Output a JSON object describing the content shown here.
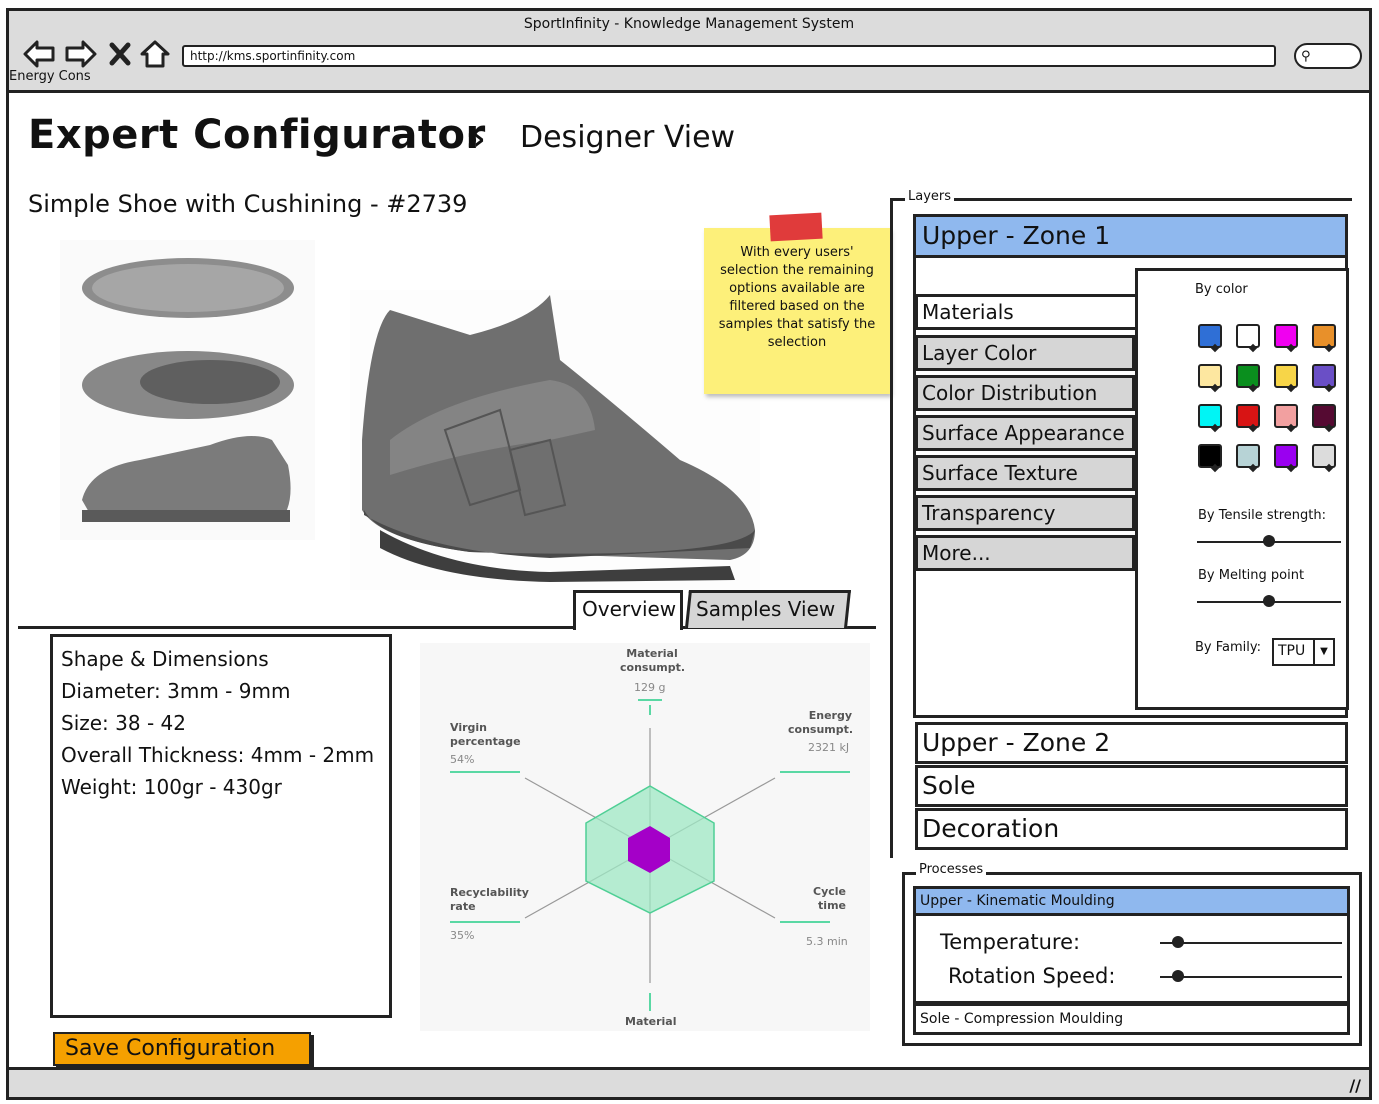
{
  "window": {
    "title": "SportInfinity - Knowledge Management System",
    "url": "http://kms.sportinfinity.com",
    "side_tab": "Energy Cons"
  },
  "header": {
    "title": "Expert Configurator",
    "separator": "»",
    "view": "Designer View"
  },
  "product": {
    "title": "Simple Shoe with Cushining - #2739"
  },
  "sticky_note": "With every users' selection the remaining options available are filtered based on the samples that satisfy the selection",
  "tabs": [
    {
      "label": "Overview",
      "active": true
    },
    {
      "label": "Samples View",
      "active": false
    }
  ],
  "dimensions": {
    "heading": "Shape & Dimensions",
    "lines": [
      "Diameter: 3mm - 9mm",
      "Size: 38 - 42",
      "Overall Thickness: 4mm - 2mm",
      "Weight: 100gr - 430gr"
    ]
  },
  "radar": {
    "axes": [
      {
        "label": "Material consumpt.",
        "value": "129 g"
      },
      {
        "label": "Energy consumpt.",
        "value": "2321 kJ"
      },
      {
        "label": "Cycle time",
        "value": "5.3 min"
      },
      {
        "label": "Material",
        "value": ""
      },
      {
        "label": "Recyclability rate",
        "value": "35%"
      },
      {
        "label": "Virgin percentage",
        "value": "54%"
      }
    ],
    "colors": {
      "outer": "#9fe8c4",
      "inner": "#a400c8",
      "axis": "#999999"
    }
  },
  "save_button": "Save Configuration",
  "layers": {
    "legend": "Layers",
    "selected_zone": "Upper - Zone 1",
    "categories": [
      "Materials",
      "Layer Color",
      "Color Distribution",
      "Surface Appearance",
      "Surface Texture",
      "Transparency",
      "More..."
    ],
    "selected_category": "Materials",
    "filters": {
      "by_color_label": "By color",
      "colors": [
        "#2f6fd6",
        "#ffffff",
        "#f000f0",
        "#e8902a",
        "#fde7a0",
        "#0a8f1e",
        "#f7d548",
        "#6a4fc6",
        "#00f5f5",
        "#d81414",
        "#f2a0a0",
        "#550a32",
        "#000000",
        "#b7d3d6",
        "#9a00f0",
        "#dcdcdc"
      ],
      "tensile_label": "By Tensile strength:",
      "tensile_value": 0.5,
      "melting_label": "By Melting point",
      "melting_value": 0.5,
      "family_label": "By Family:",
      "family_value": "TPU"
    },
    "other_zones": [
      "Upper - Zone 2",
      "Sole",
      "Decoration"
    ]
  },
  "processes": {
    "legend": "Processes",
    "selected": "Upper - Kinematic Moulding",
    "params": [
      {
        "label": "Temperature:",
        "value": 0.1
      },
      {
        "label": "Rotation Speed:",
        "value": 0.1
      }
    ],
    "other": "Sole - Compression Moulding"
  }
}
